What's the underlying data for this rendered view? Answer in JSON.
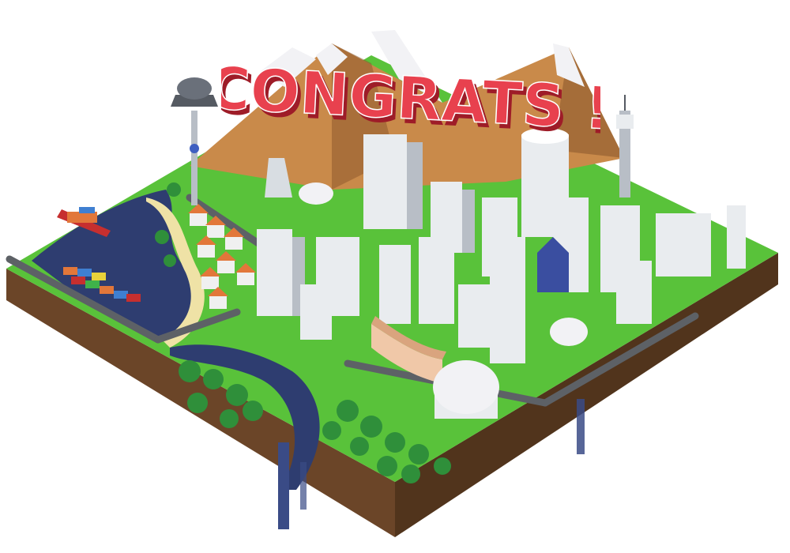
{
  "banner": {
    "text": "CONGRATS !"
  },
  "colors": {
    "banner_fill": "#e8414e",
    "banner_shadow": "#9e1c28",
    "grass": "#59c23a",
    "grass_dark": "#3f9a2b",
    "water": "#2e3d70",
    "soil_top": "#7a5233",
    "soil_side": "#5a3a22",
    "sand": "#efe2a6",
    "mountain_light": "#c98a4a",
    "mountain_dark": "#8e5a2e",
    "snow": "#f2f2f5",
    "building": "#e9ecef",
    "building_shade": "#b8bec6",
    "road": "#5d6166",
    "roof_orange": "#e2773a",
    "tree": "#2f8f3a"
  },
  "scene": {
    "name": "isometric-city-island",
    "icons": [
      "observation-tower-icon",
      "cargo-ship-icon",
      "container-stack-icon",
      "dome-icon",
      "radio-tower-icon",
      "waterfall-icon"
    ]
  }
}
